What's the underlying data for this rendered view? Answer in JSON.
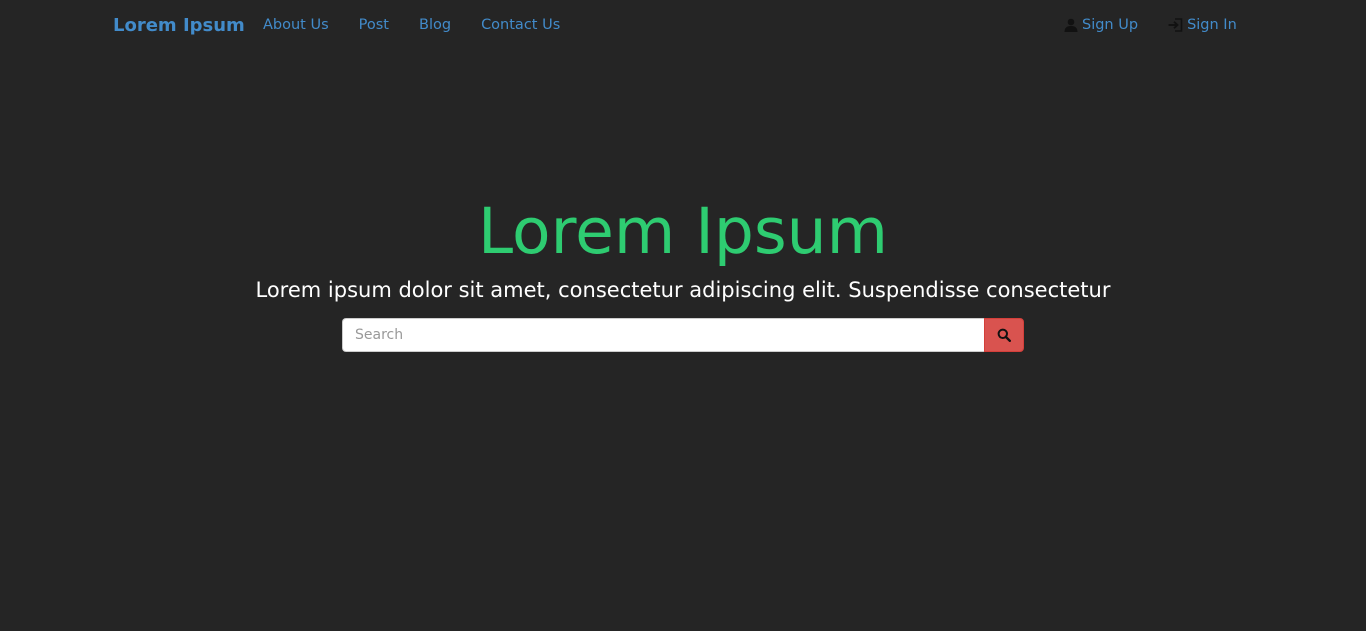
{
  "navbar": {
    "brand": "Lorem Ipsum",
    "links": [
      {
        "label": "About Us"
      },
      {
        "label": "Post"
      },
      {
        "label": "Blog"
      },
      {
        "label": "Contact Us"
      }
    ],
    "right_links": [
      {
        "label": "Sign Up",
        "icon": "user-icon"
      },
      {
        "label": "Sign In",
        "icon": "log-in-icon"
      }
    ]
  },
  "hero": {
    "title": "Lorem Ipsum",
    "subtitle": "Lorem ipsum dolor sit amet, consectetur adipiscing elit. Suspendisse consectetur"
  },
  "search": {
    "placeholder": "Search",
    "value": "",
    "button_icon": "search-icon"
  },
  "colors": {
    "background": "#252525",
    "link": "#428bca",
    "title": "#2ecc71",
    "search_button": "#d9534f"
  }
}
